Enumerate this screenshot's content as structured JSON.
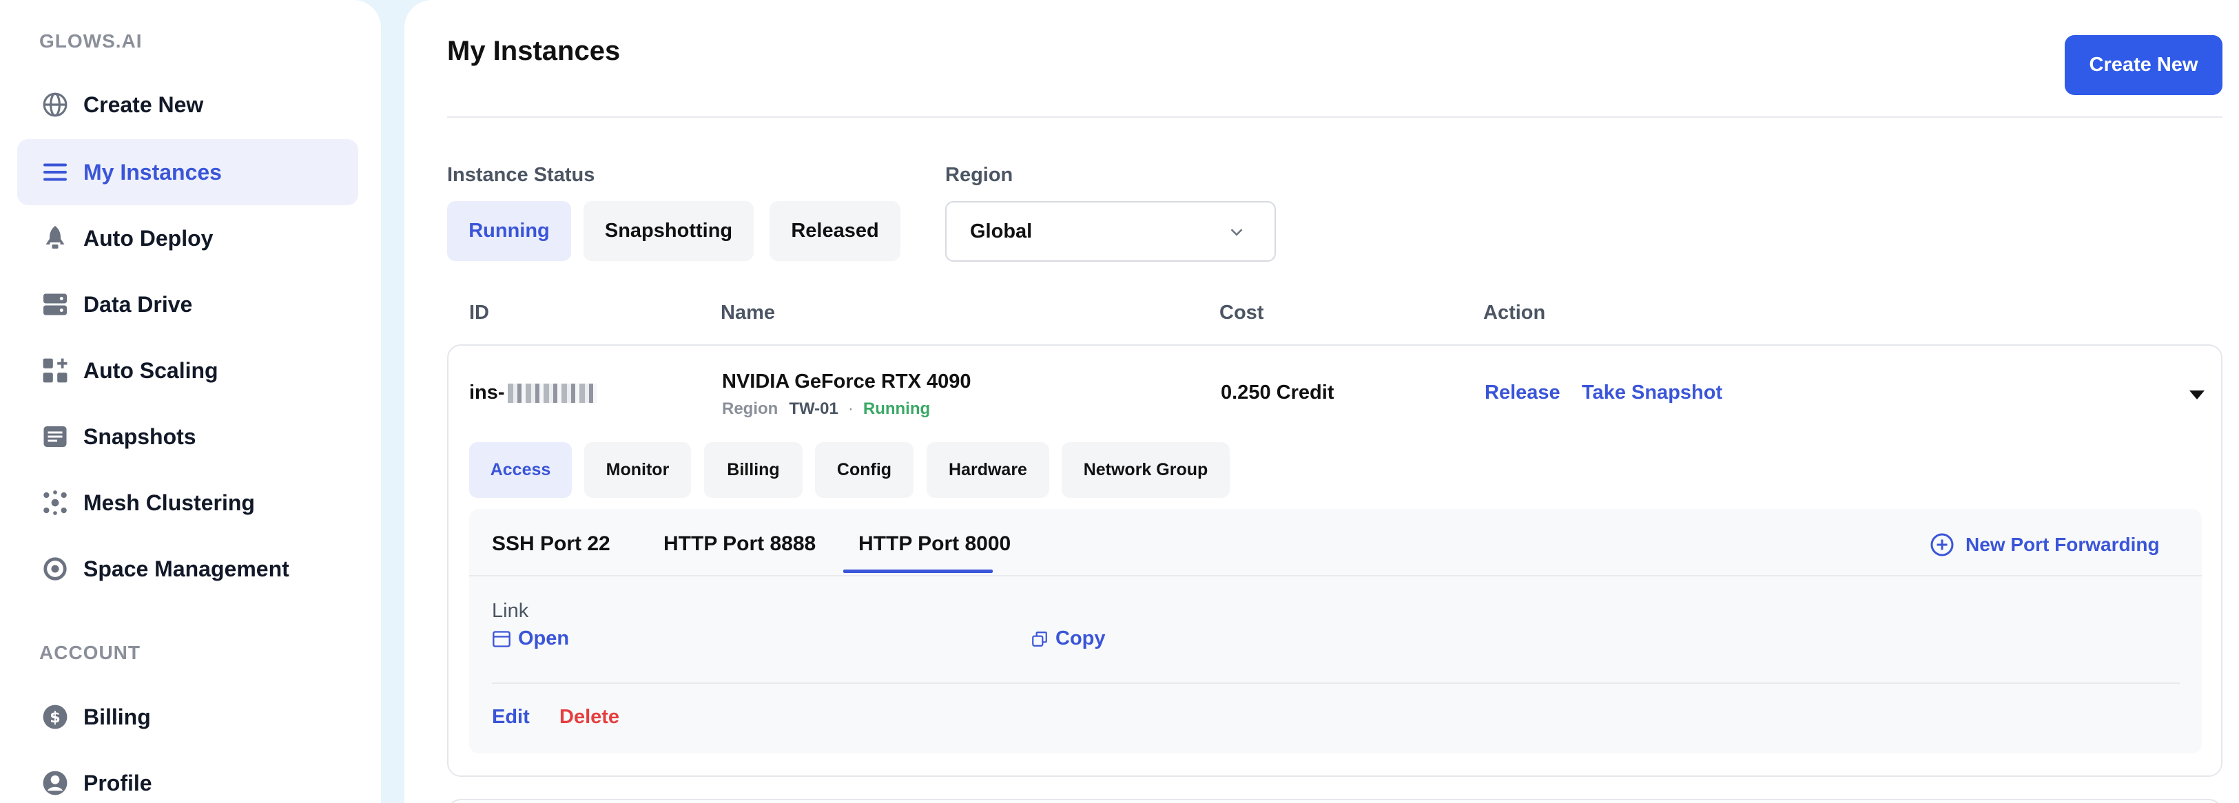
{
  "sidebar": {
    "brand": "GLOWS.AI",
    "items": [
      {
        "label": "Create New",
        "icon": "globe-icon"
      },
      {
        "label": "My Instances",
        "icon": "list-icon"
      },
      {
        "label": "Auto Deploy",
        "icon": "rocket-icon"
      },
      {
        "label": "Data Drive",
        "icon": "server-icon"
      },
      {
        "label": "Auto Scaling",
        "icon": "grid-plus-icon"
      },
      {
        "label": "Snapshots",
        "icon": "document-icon"
      },
      {
        "label": "Mesh Clustering",
        "icon": "mesh-icon"
      },
      {
        "label": "Space Management",
        "icon": "gauge-icon"
      }
    ],
    "account_section": "ACCOUNT",
    "account_items": [
      {
        "label": "Billing",
        "icon": "dollar-icon"
      },
      {
        "label": "Profile",
        "icon": "user-icon"
      }
    ]
  },
  "header": {
    "title": "My Instances",
    "create_button": "Create New"
  },
  "filters": {
    "status_label": "Instance Status",
    "status_options": [
      "Running",
      "Snapshotting",
      "Released"
    ],
    "region_label": "Region",
    "region_value": "Global"
  },
  "table": {
    "columns": [
      "ID",
      "Name",
      "Cost",
      "Action"
    ]
  },
  "instance": {
    "id_prefix": "ins-",
    "name": "NVIDIA GeForce RTX 4090",
    "region_key": "Region",
    "region_value": "TW-01",
    "separator": "·",
    "status": "Running",
    "cost": "0.250 Credit",
    "actions": [
      "Release",
      "Take Snapshot"
    ],
    "tabs": [
      "Access",
      "Monitor",
      "Billing",
      "Config",
      "Hardware",
      "Network Group"
    ],
    "ports": [
      "SSH Port 22",
      "HTTP Port 8888",
      "HTTP Port 8000"
    ],
    "new_port": "New Port Forwarding",
    "link_label": "Link",
    "open_label": "Open",
    "copy_label": "Copy",
    "edit_label": "Edit",
    "delete_label": "Delete"
  },
  "colors": {
    "accent": "#2f5be8",
    "link": "#3a55d8",
    "running": "#3aa865",
    "danger": "#e53e3e"
  }
}
